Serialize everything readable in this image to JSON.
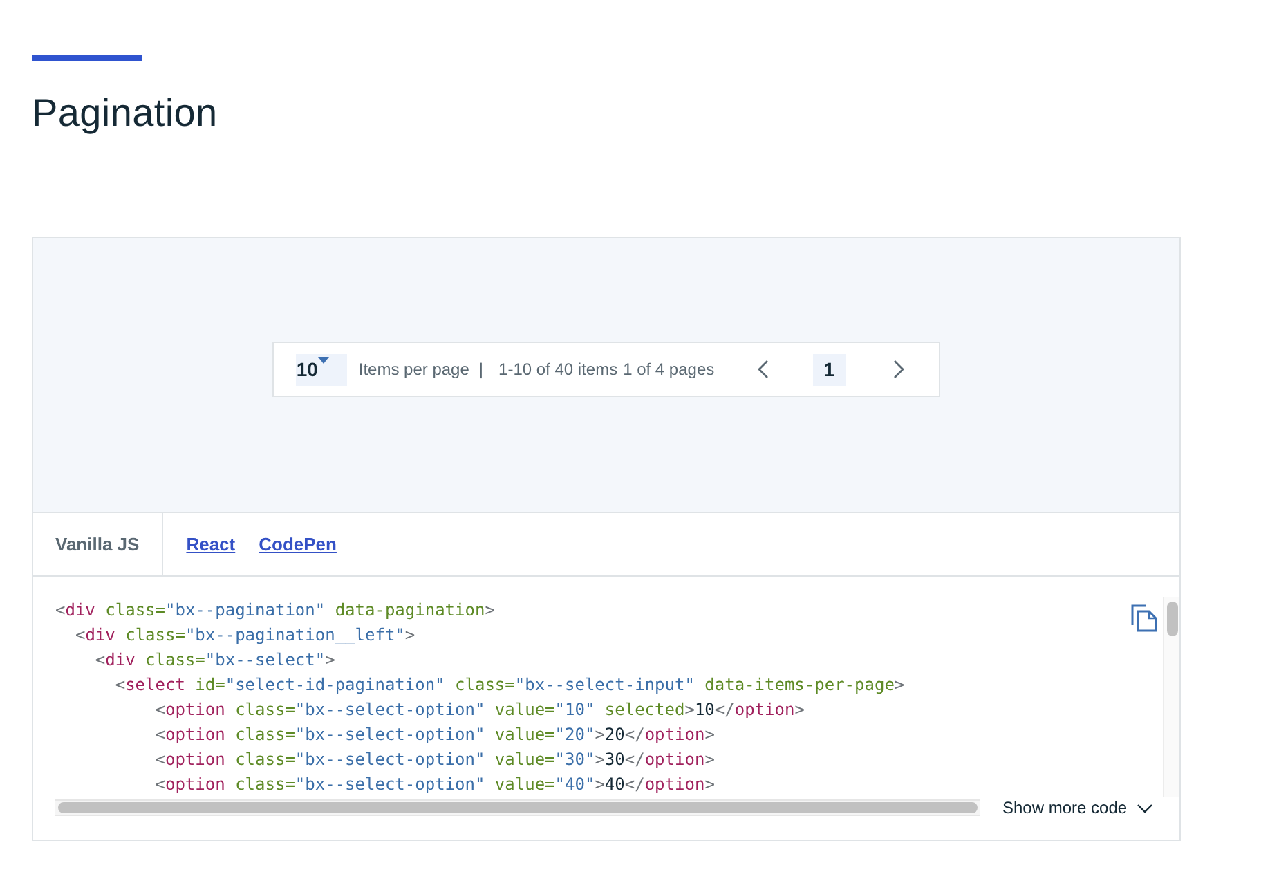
{
  "title": "Pagination",
  "demo": {
    "pagination": {
      "items_per_page": "10",
      "items_per_page_label": "Items per page",
      "separator": "|",
      "range_text": "1-10 of 40 items",
      "page_count_text": "1 of 4 pages",
      "current_page": "1"
    }
  },
  "tabs": [
    {
      "label": "Vanilla JS",
      "selected": true
    },
    {
      "label": "React",
      "selected": false
    },
    {
      "label": "CodePen",
      "selected": false
    }
  ],
  "code": {
    "lines": [
      [
        {
          "kind": "punct",
          "text": "<"
        },
        {
          "kind": "tag",
          "text": "div"
        },
        {
          "kind": "attr",
          "text": " class="
        },
        {
          "kind": "string",
          "text": "\"bx--pagination\""
        },
        {
          "kind": "attr",
          "text": " data-pagination"
        },
        {
          "kind": "punct",
          "text": ">"
        }
      ],
      [
        {
          "kind": "punct",
          "text": "  <"
        },
        {
          "kind": "tag",
          "text": "div"
        },
        {
          "kind": "attr",
          "text": " class="
        },
        {
          "kind": "string",
          "text": "\"bx--pagination__left\""
        },
        {
          "kind": "punct",
          "text": ">"
        }
      ],
      [
        {
          "kind": "punct",
          "text": "    <"
        },
        {
          "kind": "tag",
          "text": "div"
        },
        {
          "kind": "attr",
          "text": " class="
        },
        {
          "kind": "string",
          "text": "\"bx--select\""
        },
        {
          "kind": "punct",
          "text": ">"
        }
      ],
      [
        {
          "kind": "punct",
          "text": "      <"
        },
        {
          "kind": "tag",
          "text": "select"
        },
        {
          "kind": "attr",
          "text": " id="
        },
        {
          "kind": "string",
          "text": "\"select-id-pagination\""
        },
        {
          "kind": "attr",
          "text": " class="
        },
        {
          "kind": "string",
          "text": "\"bx--select-input\""
        },
        {
          "kind": "attr",
          "text": " data-items-per-page"
        },
        {
          "kind": "punct",
          "text": ">"
        }
      ],
      [
        {
          "kind": "punct",
          "text": "          <"
        },
        {
          "kind": "tag",
          "text": "option"
        },
        {
          "kind": "attr",
          "text": " class="
        },
        {
          "kind": "string",
          "text": "\"bx--select-option\""
        },
        {
          "kind": "attr",
          "text": " value="
        },
        {
          "kind": "string",
          "text": "\"10\""
        },
        {
          "kind": "attr",
          "text": " selected"
        },
        {
          "kind": "punct",
          "text": ">"
        },
        {
          "kind": "text",
          "text": "10"
        },
        {
          "kind": "punct",
          "text": "</"
        },
        {
          "kind": "tag",
          "text": "option"
        },
        {
          "kind": "punct",
          "text": ">"
        }
      ],
      [
        {
          "kind": "punct",
          "text": "          <"
        },
        {
          "kind": "tag",
          "text": "option"
        },
        {
          "kind": "attr",
          "text": " class="
        },
        {
          "kind": "string",
          "text": "\"bx--select-option\""
        },
        {
          "kind": "attr",
          "text": " value="
        },
        {
          "kind": "string",
          "text": "\"20\""
        },
        {
          "kind": "punct",
          "text": ">"
        },
        {
          "kind": "text",
          "text": "20"
        },
        {
          "kind": "punct",
          "text": "</"
        },
        {
          "kind": "tag",
          "text": "option"
        },
        {
          "kind": "punct",
          "text": ">"
        }
      ],
      [
        {
          "kind": "punct",
          "text": "          <"
        },
        {
          "kind": "tag",
          "text": "option"
        },
        {
          "kind": "attr",
          "text": " class="
        },
        {
          "kind": "string",
          "text": "\"bx--select-option\""
        },
        {
          "kind": "attr",
          "text": " value="
        },
        {
          "kind": "string",
          "text": "\"30\""
        },
        {
          "kind": "punct",
          "text": ">"
        },
        {
          "kind": "text",
          "text": "30"
        },
        {
          "kind": "punct",
          "text": "</"
        },
        {
          "kind": "tag",
          "text": "option"
        },
        {
          "kind": "punct",
          "text": ">"
        }
      ],
      [
        {
          "kind": "punct",
          "text": "          <"
        },
        {
          "kind": "tag",
          "text": "option"
        },
        {
          "kind": "attr",
          "text": " class="
        },
        {
          "kind": "string",
          "text": "\"bx--select-option\""
        },
        {
          "kind": "attr",
          "text": " value="
        },
        {
          "kind": "string",
          "text": "\"40\""
        },
        {
          "kind": "punct",
          "text": ">"
        },
        {
          "kind": "text",
          "text": "40"
        },
        {
          "kind": "punct",
          "text": "</"
        },
        {
          "kind": "tag",
          "text": "option"
        },
        {
          "kind": "punct",
          "text": ">"
        }
      ]
    ]
  },
  "show_more": {
    "label": "Show more code"
  }
}
